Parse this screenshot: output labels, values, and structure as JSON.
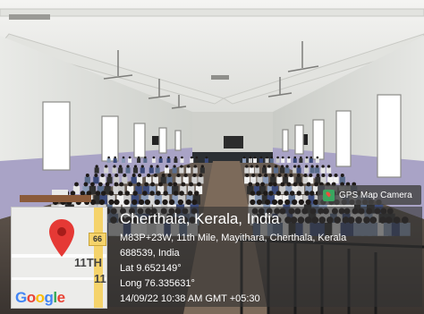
{
  "camera_badge": {
    "label": "GPS Map Camera",
    "icon": "gps-map-camera-icon"
  },
  "location": {
    "city": "Cherthala, Kerala, India",
    "address_line1": "M83P+23W, 11th Mile, Mayithara, Cherthala, Kerala",
    "address_line2": "688539, India",
    "latitude": "Lat 9.652149°",
    "longitude": "Long 76.335631°",
    "datetime": "14/09/22 10:38 AM GMT +05:30"
  },
  "map": {
    "road_shield": "66",
    "label_11th": "11TH",
    "label_11": "11",
    "logo": "Google",
    "pin_color": "#e53935",
    "logo_colors": [
      "#4285f4",
      "#ea4335",
      "#fbbc05",
      "#4285f4",
      "#34a853",
      "#ea4335"
    ]
  }
}
